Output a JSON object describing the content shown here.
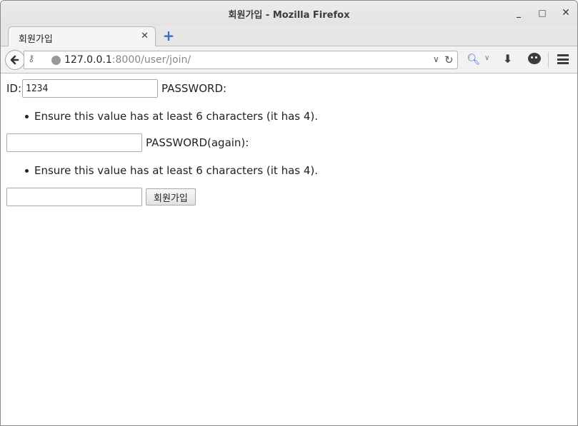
{
  "window": {
    "title": "회원가입 - Mozilla Firefox",
    "controls": {
      "minimize": "_",
      "maximize": "□",
      "close": "✕"
    }
  },
  "tabs": [
    {
      "label": "회원가입",
      "close": "✕"
    }
  ],
  "newtab_label": "+",
  "urlbar": {
    "host": "127.0.0.1",
    "path": ":8000/user/join/"
  },
  "icons": {
    "back": "back-arrow-icon",
    "identity": "key-icon",
    "site": "globe-icon",
    "history_dropdown": "chevron-down-icon",
    "reload": "reload-icon",
    "search": "search-icon",
    "download": "download-icon",
    "chat": "chat-icon",
    "menu": "hamburger-menu-icon"
  },
  "form": {
    "id_label": "ID:",
    "id_value": "1234",
    "password_label": "PASSWORD:",
    "password_error": "Ensure this value has at least 6 characters (it has 4).",
    "password_value": "",
    "password_again_label": "PASSWORD(again):",
    "password_again_error": "Ensure this value has at least 6 characters (it has 4).",
    "password_again_value": "",
    "submit_label": "회원가입"
  }
}
